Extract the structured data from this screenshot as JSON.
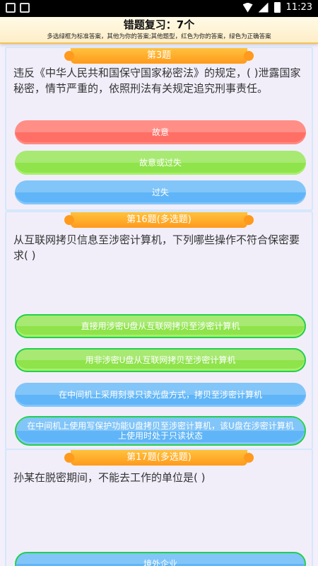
{
  "status_bar": {
    "time": "11:23"
  },
  "header": {
    "title": "错题复习：7个",
    "subtitle": "多选绿框为标准答案，其他为你的答案;其他题型，红色为你的答案，绿色为正确答案"
  },
  "questions": [
    {
      "ribbon": "第3题",
      "text": "违反《中华人民共和国保守国家秘密法》的规定，( )泄露国家秘密，情节严重的，依照刑法有关规定追究刑事责任。",
      "options": [
        {
          "label": "故意"
        },
        {
          "label": "故意或过失"
        },
        {
          "label": "过失"
        }
      ]
    },
    {
      "ribbon": "第16题(多选题)",
      "text": "从互联网拷贝信息至涉密计算机，下列哪些操作不符合保密要求( )",
      "options": [
        {
          "label": "直接用涉密U盘从互联网拷贝至涉密计算机"
        },
        {
          "label": "用非涉密U盘从互联网拷贝至涉密计算机"
        },
        {
          "label": "在中间机上采用刻录只读光盘方式，拷贝至涉密计算机"
        },
        {
          "label": "在中间机上使用写保护功能U盘拷贝至涉密计算机，该U盘在涉密计算机上使用时处于只读状态"
        }
      ]
    },
    {
      "ribbon": "第17题(多选题)",
      "text": "孙某在脱密期间，不能去工作的单位是( )",
      "options": [
        {
          "label": "境外企业"
        }
      ]
    }
  ],
  "colors": {
    "wrong": "#ff6f66",
    "correct": "#8fe34b",
    "neutral": "#5fb5f7",
    "correct_border": "#23d04d",
    "ribbon": "#ff9a1c"
  }
}
